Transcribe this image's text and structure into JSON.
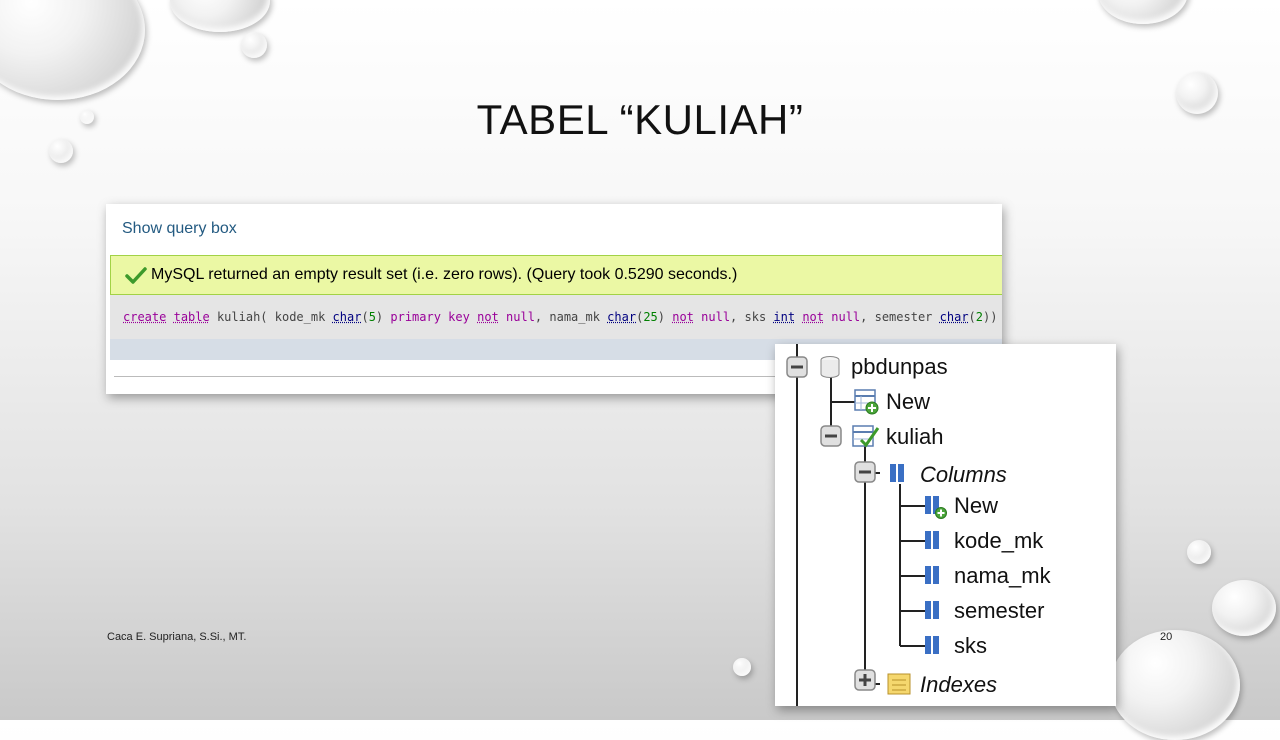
{
  "slide": {
    "title": "TABEL “KULIAH”",
    "author": "Caca E. Supriana, S.Si., MT.",
    "page_number": "20"
  },
  "query_panel": {
    "show_query_box": "Show query box",
    "success_message": "MySQL returned an empty result set (i.e. zero rows). (Query took 0.5290 seconds.)",
    "sql_tokens": [
      {
        "t": "create",
        "c": "kw"
      },
      {
        "t": " ",
        "c": ""
      },
      {
        "t": "table",
        "c": "kw"
      },
      {
        "t": " kuliah( kode_mk ",
        "c": ""
      },
      {
        "t": "char",
        "c": "ty"
      },
      {
        "t": "(",
        "c": ""
      },
      {
        "t": "5",
        "c": "num"
      },
      {
        "t": ") ",
        "c": ""
      },
      {
        "t": "primary key",
        "c": "kwp"
      },
      {
        "t": " ",
        "c": ""
      },
      {
        "t": "not",
        "c": "kw"
      },
      {
        "t": " ",
        "c": ""
      },
      {
        "t": "null",
        "c": "kwp"
      },
      {
        "t": ", nama_mk ",
        "c": ""
      },
      {
        "t": "char",
        "c": "ty"
      },
      {
        "t": "(",
        "c": ""
      },
      {
        "t": "25",
        "c": "num"
      },
      {
        "t": ") ",
        "c": ""
      },
      {
        "t": "not",
        "c": "kw"
      },
      {
        "t": " ",
        "c": ""
      },
      {
        "t": "null",
        "c": "kwp"
      },
      {
        "t": ", sks ",
        "c": ""
      },
      {
        "t": "int",
        "c": "ty"
      },
      {
        "t": " ",
        "c": ""
      },
      {
        "t": "not",
        "c": "kw"
      },
      {
        "t": " ",
        "c": ""
      },
      {
        "t": "null",
        "c": "kwp"
      },
      {
        "t": ", semester ",
        "c": ""
      },
      {
        "t": "char",
        "c": "ty"
      },
      {
        "t": "(",
        "c": ""
      },
      {
        "t": "2",
        "c": "num"
      },
      {
        "t": "))",
        "c": ""
      }
    ],
    "colors": {
      "success_bg": "#ebf8a4",
      "success_border": "#a2d246",
      "link": "#235a81",
      "keyword": "#990099",
      "type": "#000080",
      "number": "#008000"
    }
  },
  "navigation_tree": {
    "database": "pbdunpas",
    "new_table": "New",
    "table": "kuliah",
    "columns_label": "Columns",
    "new_column": "New",
    "columns": [
      "kode_mk",
      "nama_mk",
      "semester",
      "sks"
    ],
    "indexes_label": "Indexes",
    "icons": {
      "database": "database-icon",
      "new_table": "new-table-icon",
      "table": "table-icon",
      "columns": "columns-icon",
      "new_column": "new-column-icon",
      "column": "column-icon",
      "indexes": "indexes-icon",
      "collapse": "collapse-icon",
      "expand": "expand-icon"
    }
  }
}
